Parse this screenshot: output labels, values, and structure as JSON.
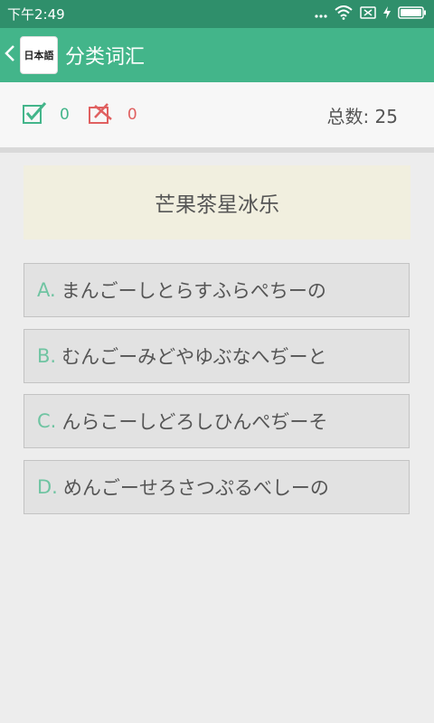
{
  "status_bar": {
    "time": "下午2:49"
  },
  "header": {
    "title": "分类词汇",
    "logo_text": "日本語"
  },
  "score": {
    "correct": "0",
    "wrong": "0",
    "total_label": "总数: 25"
  },
  "question": {
    "text": "芒果茶星冰乐"
  },
  "options": [
    {
      "letter": "A.",
      "text": "まんごーしとらすふらぺちーの"
    },
    {
      "letter": "B.",
      "text": "むんごーみどやゆぶなへぢーと"
    },
    {
      "letter": "C.",
      "text": "んらこーしどろしひんぺぢーそ"
    },
    {
      "letter": "D.",
      "text": "めんごーせろさつぷるべしーの"
    }
  ],
  "colors": {
    "accent": "#43b58a",
    "status_bar": "#2f8f6b",
    "wrong": "#e06060",
    "question_bg": "#f1efdf"
  },
  "icons": [
    "back-chevron-icon",
    "checkbox-correct-icon",
    "wrong-pencil-icon",
    "more-dots-icon",
    "wifi-icon",
    "sim-icon",
    "charging-icon",
    "battery-icon"
  ]
}
